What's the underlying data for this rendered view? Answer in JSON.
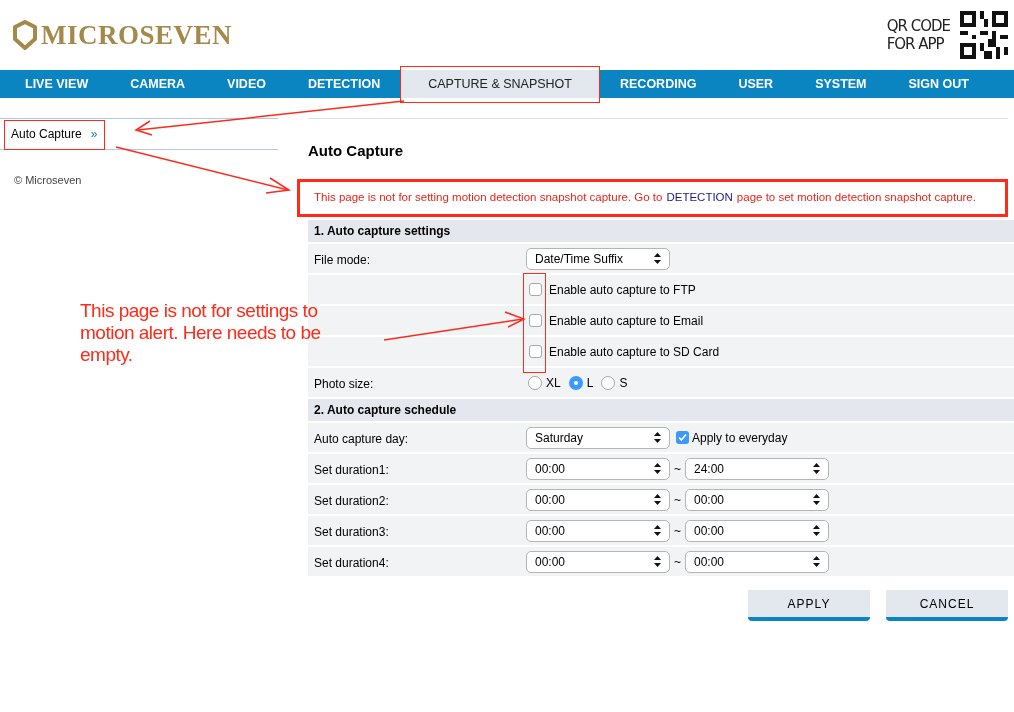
{
  "logo": {
    "text": "MICROSEVEN"
  },
  "qr": {
    "lines": [
      "QR CODE",
      "FOR APP"
    ]
  },
  "nav": [
    {
      "label": "LIVE VIEW",
      "selected": false,
      "highlighted": false
    },
    {
      "label": "CAMERA",
      "selected": false,
      "highlighted": false
    },
    {
      "label": "VIDEO",
      "selected": false,
      "highlighted": false
    },
    {
      "label": "DETECTION",
      "selected": false,
      "highlighted": false
    },
    {
      "label": "CAPTURE & SNAPSHOT",
      "selected": true,
      "highlighted": true
    },
    {
      "label": "RECORDING",
      "selected": false,
      "highlighted": false
    },
    {
      "label": "USER",
      "selected": false,
      "highlighted": false
    },
    {
      "label": "SYSTEM",
      "selected": false,
      "highlighted": false
    },
    {
      "label": "SIGN OUT",
      "selected": false,
      "highlighted": false
    }
  ],
  "sidebar": {
    "items": [
      {
        "label": "Auto Capture",
        "marker": "»",
        "selected": true,
        "highlighted": true
      }
    ],
    "copyright": "© Microseven"
  },
  "page_title": "Auto Capture",
  "notice": {
    "before": "This page is not for setting motion detection snapshot capture. Go to",
    "link": "DETECTION",
    "after": "page to set motion detection snapshot capture.",
    "highlighted": true
  },
  "sections": [
    {
      "title": "1. Auto capture settings",
      "rows": [
        {
          "kind": "select",
          "label": "File mode:",
          "value": "Date/Time Suffix"
        },
        {
          "kind": "checkbox_group",
          "highlighted": true,
          "items": [
            {
              "label": "Enable auto capture to FTP",
              "checked": false
            },
            {
              "label": "Enable auto capture to Email",
              "checked": false
            },
            {
              "label": "Enable auto capture to SD Card",
              "checked": false
            }
          ]
        },
        {
          "kind": "radio",
          "label": "Photo size:",
          "options": [
            {
              "label": "XL",
              "selected": false
            },
            {
              "label": "L",
              "selected": true
            },
            {
              "label": "S",
              "selected": false
            }
          ]
        }
      ]
    },
    {
      "title": "2. Auto capture schedule",
      "rows": [
        {
          "kind": "day",
          "label": "Auto capture day:",
          "value": "Saturday",
          "check": {
            "label": "Apply to everyday",
            "checked": true
          }
        },
        {
          "kind": "range",
          "label": "Set duration1:",
          "from": "00:00",
          "separator": "~",
          "to": "24:00"
        },
        {
          "kind": "range",
          "label": "Set duration2:",
          "from": "00:00",
          "separator": "~",
          "to": "00:00"
        },
        {
          "kind": "range",
          "label": "Set duration3:",
          "from": "00:00",
          "separator": "~",
          "to": "00:00"
        },
        {
          "kind": "range",
          "label": "Set duration4:",
          "from": "00:00",
          "separator": "~",
          "to": "00:00"
        }
      ]
    }
  ],
  "buttons": [
    "APPLY",
    "CANCEL"
  ],
  "annotation": {
    "text": "This page is not for settings to motion alert. Here needs to be empty."
  }
}
